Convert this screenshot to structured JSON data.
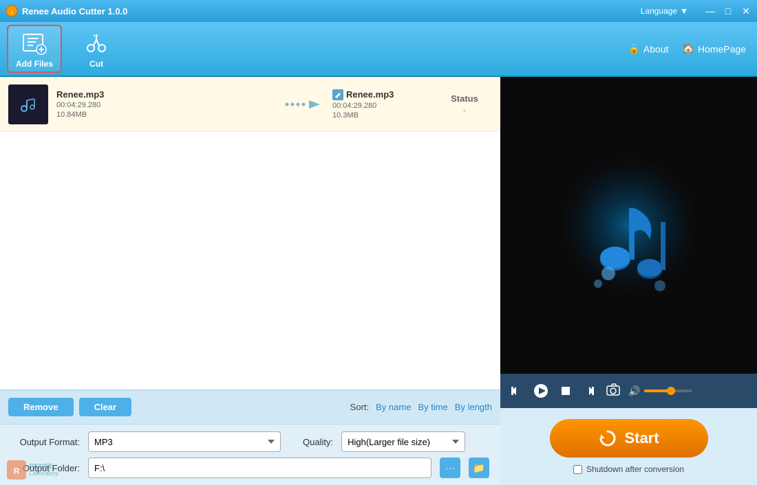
{
  "app": {
    "title": "Renee Audio Cutter 1.0.0",
    "language_label": "Language",
    "about_label": "About",
    "homepage_label": "HomePage"
  },
  "toolbar": {
    "add_files_label": "Add Files",
    "cut_label": "Cut"
  },
  "file_list": {
    "columns": [
      "",
      "",
      "",
      "Status"
    ],
    "rows": [
      {
        "source_name": "Renee.mp3",
        "source_duration": "00:04:29.280",
        "source_size": "10.84MB",
        "output_name": "Renee.mp3",
        "output_duration": "00:04:29.280",
        "output_size": "10.3MB",
        "status_label": "Status",
        "status_value": "-"
      }
    ]
  },
  "bottom_bar": {
    "remove_label": "Remove",
    "clear_label": "Clear",
    "sort_label": "Sort:",
    "sort_by_name": "By name",
    "sort_by_time": "By time",
    "sort_by_length": "By length"
  },
  "settings": {
    "output_format_label": "Output Format:",
    "output_format_value": "MP3",
    "quality_label": "Quality:",
    "quality_value": "High(Larger file size)",
    "output_folder_label": "Output Folder:",
    "output_folder_value": "F:\\"
  },
  "player": {
    "volume_pct": 55
  },
  "action": {
    "start_label": "Start",
    "shutdown_label": "Shutdown after conversion"
  },
  "watermark": {
    "line1": "RENEE",
    "line2": "Laboratory"
  }
}
